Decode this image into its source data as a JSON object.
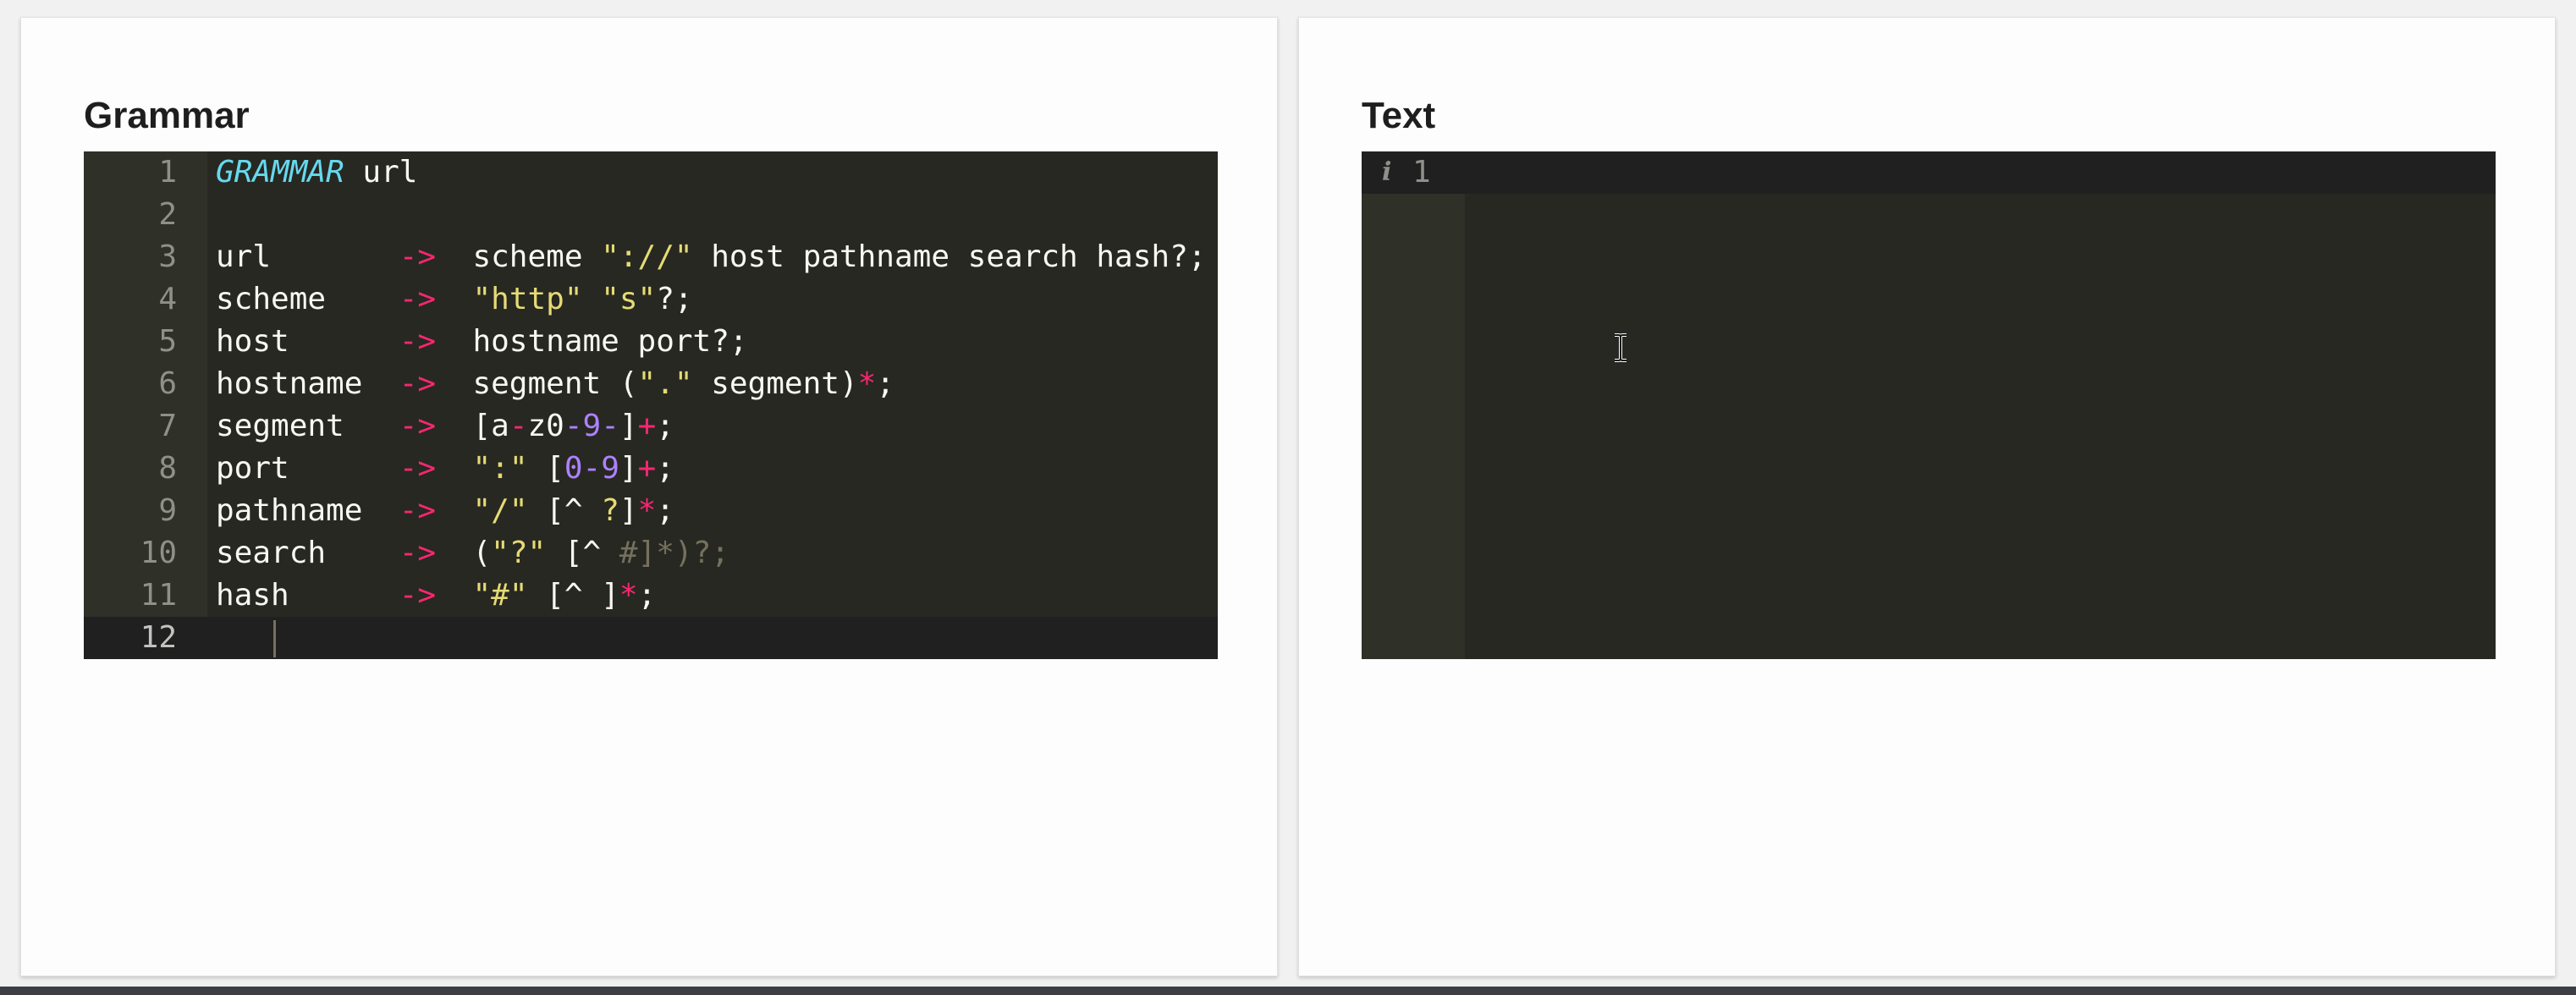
{
  "grammar_panel": {
    "title": "Grammar",
    "lines": [
      {
        "number": "1",
        "tokens": [
          {
            "t": "GRAMMAR",
            "c": "kw"
          },
          {
            "t": " url",
            "c": ""
          }
        ]
      },
      {
        "number": "2",
        "tokens": []
      },
      {
        "number": "3",
        "tokens": [
          {
            "t": "url       ",
            "c": ""
          },
          {
            "t": "->",
            "c": "op"
          },
          {
            "t": "  scheme ",
            "c": ""
          },
          {
            "t": "\"://\"",
            "c": "str"
          },
          {
            "t": " host pathname search hash?;",
            "c": ""
          }
        ]
      },
      {
        "number": "4",
        "tokens": [
          {
            "t": "scheme    ",
            "c": ""
          },
          {
            "t": "->",
            "c": "op"
          },
          {
            "t": "  ",
            "c": ""
          },
          {
            "t": "\"http\"",
            "c": "str"
          },
          {
            "t": " ",
            "c": ""
          },
          {
            "t": "\"s\"",
            "c": "str"
          },
          {
            "t": "?;",
            "c": ""
          }
        ]
      },
      {
        "number": "5",
        "tokens": [
          {
            "t": "host      ",
            "c": ""
          },
          {
            "t": "->",
            "c": "op"
          },
          {
            "t": "  hostname port?;",
            "c": ""
          }
        ]
      },
      {
        "number": "6",
        "tokens": [
          {
            "t": "hostname  ",
            "c": ""
          },
          {
            "t": "->",
            "c": "op"
          },
          {
            "t": "  segment (",
            "c": ""
          },
          {
            "t": "\".\"",
            "c": "str"
          },
          {
            "t": " segment)",
            "c": ""
          },
          {
            "t": "*",
            "c": "op"
          },
          {
            "t": ";",
            "c": ""
          }
        ]
      },
      {
        "number": "7",
        "tokens": [
          {
            "t": "segment   ",
            "c": ""
          },
          {
            "t": "->",
            "c": "op"
          },
          {
            "t": "  [a",
            "c": ""
          },
          {
            "t": "-",
            "c": "op"
          },
          {
            "t": "z0",
            "c": ""
          },
          {
            "t": "-9-",
            "c": "num"
          },
          {
            "t": "]",
            "c": ""
          },
          {
            "t": "+",
            "c": "op"
          },
          {
            "t": ";",
            "c": ""
          }
        ]
      },
      {
        "number": "8",
        "tokens": [
          {
            "t": "port      ",
            "c": ""
          },
          {
            "t": "->",
            "c": "op"
          },
          {
            "t": "  ",
            "c": ""
          },
          {
            "t": "\":\"",
            "c": "str"
          },
          {
            "t": " [",
            "c": ""
          },
          {
            "t": "0-9",
            "c": "num"
          },
          {
            "t": "]",
            "c": ""
          },
          {
            "t": "+",
            "c": "op"
          },
          {
            "t": ";",
            "c": ""
          }
        ]
      },
      {
        "number": "9",
        "tokens": [
          {
            "t": "pathname  ",
            "c": ""
          },
          {
            "t": "->",
            "c": "op"
          },
          {
            "t": "  ",
            "c": ""
          },
          {
            "t": "\"/\"",
            "c": "str"
          },
          {
            "t": " [^ ",
            "c": ""
          },
          {
            "t": "?",
            "c": "str"
          },
          {
            "t": "]",
            "c": ""
          },
          {
            "t": "*",
            "c": "op"
          },
          {
            "t": ";",
            "c": ""
          }
        ]
      },
      {
        "number": "10",
        "tokens": [
          {
            "t": "search    ",
            "c": ""
          },
          {
            "t": "->",
            "c": "op"
          },
          {
            "t": "  (",
            "c": ""
          },
          {
            "t": "\"?\"",
            "c": "str"
          },
          {
            "t": " [^ ",
            "c": ""
          },
          {
            "t": "#]*)?;",
            "c": "cmt"
          }
        ]
      },
      {
        "number": "11",
        "tokens": [
          {
            "t": "hash      ",
            "c": ""
          },
          {
            "t": "->",
            "c": "op"
          },
          {
            "t": "  ",
            "c": ""
          },
          {
            "t": "\"#\"",
            "c": "str"
          },
          {
            "t": " [^ ]",
            "c": ""
          },
          {
            "t": "*",
            "c": "op"
          },
          {
            "t": ";",
            "c": ""
          }
        ]
      },
      {
        "number": "12",
        "tokens": [],
        "active": true
      }
    ]
  },
  "text_panel": {
    "title": "Text",
    "info_icon": "i",
    "info_icon_name": "info-icon",
    "line_number": "1"
  },
  "colors": {
    "editor_bg": "#272822",
    "gutter_bg": "#2f3129",
    "keyword": "#66d9ef",
    "operator": "#f92672",
    "string": "#e6db74",
    "number": "#ae81ff",
    "comment": "#75715e"
  }
}
